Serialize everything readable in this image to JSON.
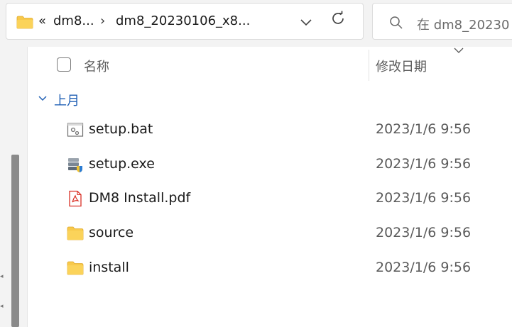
{
  "address_bar": {
    "overflow_label": "«",
    "crumbs": [
      "dm8...",
      "dm8_20230106_x8..."
    ],
    "separator": "›"
  },
  "search": {
    "placeholder": "在 dm8_20230"
  },
  "columns": {
    "name": "名称",
    "date_modified": "修改日期"
  },
  "group": {
    "label": "上月"
  },
  "files": [
    {
      "name": "setup.bat",
      "date": "2023/1/6 9:56",
      "icon": "batch-file-icon"
    },
    {
      "name": "setup.exe",
      "date": "2023/1/6 9:56",
      "icon": "installer-exe-icon"
    },
    {
      "name": "DM8 Install.pdf",
      "date": "2023/1/6 9:56",
      "icon": "pdf-icon"
    },
    {
      "name": "source",
      "date": "2023/1/6 9:56",
      "icon": "folder-icon"
    },
    {
      "name": "install",
      "date": "2023/1/6 9:56",
      "icon": "folder-icon"
    }
  ],
  "colors": {
    "folder": "#f8c94b",
    "group_label": "#1f5fb4",
    "pdf": "#d93025",
    "scroll_thumb": "#8a8a8a"
  }
}
